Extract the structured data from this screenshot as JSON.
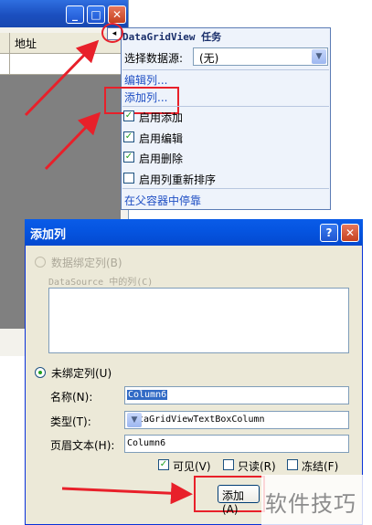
{
  "background_window": {
    "minimize_glyph": "_",
    "maximize_glyph": "□",
    "close_glyph": "✕",
    "column_header": "地址"
  },
  "task_panel": {
    "title": "DataGridView 任务",
    "smart_tag_glyph": "◂",
    "datasource_label": "选择数据源:",
    "datasource_value": "(无)",
    "edit_columns": "编辑列...",
    "add_column": "添加列...",
    "checks": [
      {
        "label": "启用添加",
        "checked": true
      },
      {
        "label": "启用编辑",
        "checked": true
      },
      {
        "label": "启用删除",
        "checked": true
      },
      {
        "label": "启用列重新排序",
        "checked": false
      }
    ],
    "dock_link": "在父容器中停靠"
  },
  "dialog": {
    "title": "添加列",
    "help_glyph": "?",
    "close_glyph": "✕",
    "bound_radio": "数据绑定列(B)",
    "datasource_columns": "DataSource 中的列(C)",
    "unbound_radio": "未绑定列(U)",
    "name_label": "名称(N):",
    "name_value": "Column6",
    "type_label": "类型(T):",
    "type_value": "DataGridViewTextBoxColumn",
    "header_label": "页眉文本(H):",
    "header_value": "Column6",
    "options": [
      {
        "label": "可见(V)",
        "checked": true
      },
      {
        "label": "只读(R)",
        "checked": false
      },
      {
        "label": "冻结(F)",
        "checked": false
      }
    ],
    "add_button": "添加(A)"
  },
  "watermark": "软件技巧",
  "colors": {
    "annotation_red": "#e8202a",
    "link_blue": "#1f4fc4",
    "xp_title_blue": "#0554e0"
  }
}
